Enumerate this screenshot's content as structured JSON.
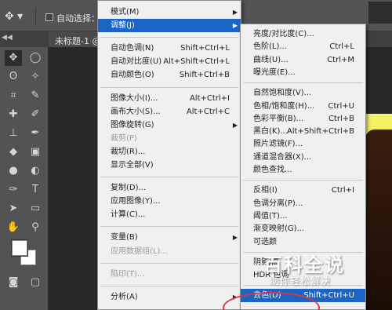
{
  "options_bar": {
    "move_tool_icon": "move-icon",
    "auto_select_label": "自动选择："
  },
  "tab": {
    "label": "未标题-1 @ 1"
  },
  "toolbar": {
    "tools": [
      "move-icon",
      "marquee-icon",
      "lasso-icon",
      "magic-wand-icon",
      "crop-icon",
      "eyedropper-icon",
      "healing-icon",
      "brush-icon",
      "stamp-icon",
      "history-brush-icon",
      "eraser-icon",
      "gradient-icon",
      "blur-icon",
      "dodge-icon",
      "pen-icon",
      "text-icon",
      "path-select-icon",
      "rectangle-icon",
      "hand-icon",
      "zoom-icon"
    ],
    "collapse_glyph": "◀◀"
  },
  "main_menu": {
    "items": [
      {
        "label": "模式(M)",
        "shortcut": "",
        "submenu": true,
        "disabled": false
      },
      {
        "label": "调整(J)",
        "shortcut": "",
        "submenu": true,
        "disabled": false,
        "highlight": true
      },
      {
        "sep": true
      },
      {
        "label": "自动色调(N)",
        "shortcut": "Shift+Ctrl+L"
      },
      {
        "label": "自动对比度(U)",
        "shortcut": "Alt+Shift+Ctrl+L"
      },
      {
        "label": "自动颜色(O)",
        "shortcut": "Shift+Ctrl+B"
      },
      {
        "sep": true
      },
      {
        "label": "图像大小(I)...",
        "shortcut": "Alt+Ctrl+I"
      },
      {
        "label": "画布大小(S)...",
        "shortcut": "Alt+Ctrl+C"
      },
      {
        "label": "图像旋转(G)",
        "shortcut": "",
        "submenu": true
      },
      {
        "label": "裁剪(P)",
        "shortcut": "",
        "disabled": true
      },
      {
        "label": "裁切(R)...",
        "shortcut": ""
      },
      {
        "label": "显示全部(V)",
        "shortcut": ""
      },
      {
        "sep": true
      },
      {
        "label": "复制(D)...",
        "shortcut": ""
      },
      {
        "label": "应用图像(Y)...",
        "shortcut": ""
      },
      {
        "label": "计算(C)...",
        "shortcut": ""
      },
      {
        "sep": true
      },
      {
        "label": "变量(B)",
        "shortcut": "",
        "submenu": true
      },
      {
        "label": "应用数据组(L)...",
        "shortcut": "",
        "disabled": true
      },
      {
        "sep": true
      },
      {
        "label": "陷印(T)...",
        "shortcut": "",
        "disabled": true
      },
      {
        "sep": true
      },
      {
        "label": "分析(A)",
        "shortcut": "",
        "submenu": true
      }
    ]
  },
  "sub_menu": {
    "items": [
      {
        "label": "亮度/对比度(C)...",
        "shortcut": ""
      },
      {
        "label": "色阶(L)...",
        "shortcut": "Ctrl+L"
      },
      {
        "label": "曲线(U)...",
        "shortcut": "Ctrl+M"
      },
      {
        "label": "曝光度(E)...",
        "shortcut": ""
      },
      {
        "sep": true
      },
      {
        "label": "自然饱和度(V)...",
        "shortcut": ""
      },
      {
        "label": "色相/饱和度(H)...",
        "shortcut": "Ctrl+U"
      },
      {
        "label": "色彩平衡(B)...",
        "shortcut": "Ctrl+B"
      },
      {
        "label": "黑白(K)...",
        "shortcut": "Alt+Shift+Ctrl+B"
      },
      {
        "label": "照片滤镜(F)...",
        "shortcut": ""
      },
      {
        "label": "通道混合器(X)...",
        "shortcut": ""
      },
      {
        "label": "颜色查找...",
        "shortcut": ""
      },
      {
        "sep": true
      },
      {
        "label": "反相(I)",
        "shortcut": "Ctrl+I"
      },
      {
        "label": "色调分离(P)...",
        "shortcut": ""
      },
      {
        "label": "阈值(T)...",
        "shortcut": ""
      },
      {
        "label": "渐变映射(G)...",
        "shortcut": ""
      },
      {
        "label": "可选颜",
        "shortcut": ""
      },
      {
        "sep": true
      },
      {
        "label": "阴影/高",
        "shortcut": ""
      },
      {
        "label": "HDR 色调",
        "shortcut": ""
      },
      {
        "sep": true
      },
      {
        "label": "去色(D)",
        "shortcut": "Shift+Ctrl+U",
        "highlight": true
      }
    ]
  },
  "watermark": {
    "title": "百科全说",
    "subtitle": "助你轻松解决"
  }
}
